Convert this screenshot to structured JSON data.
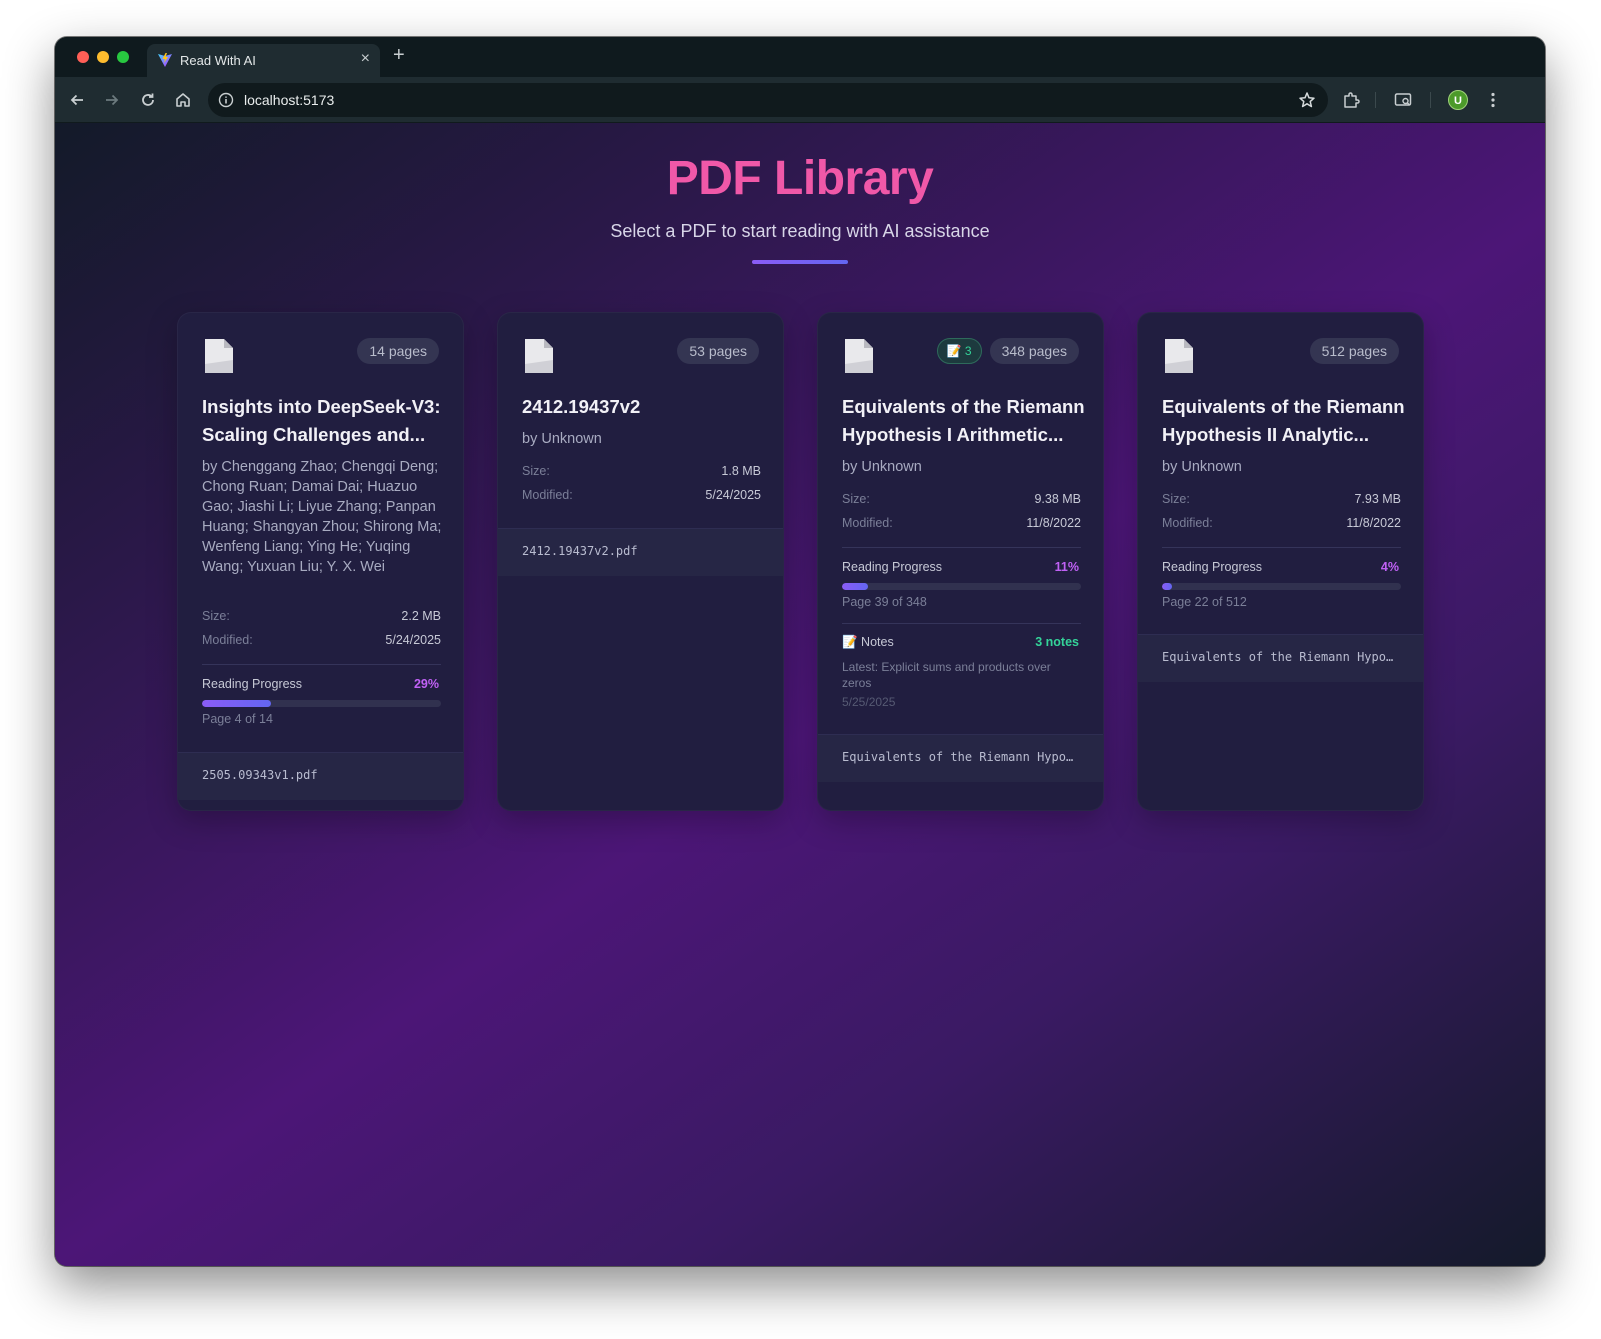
{
  "browser": {
    "tab_title": "Read With AI",
    "tab_close": "×",
    "new_tab": "+",
    "url": "localhost:5173",
    "avatar_initial": "U"
  },
  "page": {
    "title": "PDF Library",
    "subtitle": "Select a PDF to start reading with AI assistance",
    "accent_color": "#f058a8"
  },
  "labels": {
    "size": "Size:",
    "modified": "Modified:",
    "reading_progress": "Reading Progress",
    "notes": "📝 Notes"
  },
  "cards": [
    {
      "pages": "14 pages",
      "title": "Insights into DeepSeek-V3: Scaling Challenges and...",
      "author": "by Chenggang Zhao; Chengqi Deng; Chong Ruan; Damai Dai; Huazuo Gao; Jiashi Li; Liyue Zhang; Panpan Huang; Shangyan Zhou; Shirong Ma; Wenfeng Liang; Ying He; Yuqing Wang; Yuxuan Liu; Y. X. Wei",
      "size": "2.2 MB",
      "modified": "5/24/2025",
      "progress_pct": "29%",
      "progress_value": 0.29,
      "progress_page": "Page 4 of 14",
      "filename": "2505.09343v1.pdf"
    },
    {
      "pages": "53 pages",
      "title": "2412.19437v2",
      "author": "by Unknown",
      "size": "1.8 MB",
      "modified": "5/24/2025",
      "filename": "2412.19437v2.pdf"
    },
    {
      "pages": "348 pages",
      "notes_badge": "📝 3",
      "title": "Equivalents of the Riemann Hypothesis I Arithmetic...",
      "author": "by Unknown",
      "size": "9.38 MB",
      "modified": "11/8/2022",
      "progress_pct": "11%",
      "progress_value": 0.11,
      "progress_page": "Page 39 of 348",
      "notes_count": "3 notes",
      "notes_latest": "Latest: Explicit sums and products over zeros",
      "notes_date": "5/25/2025",
      "filename": "Equivalents of the Riemann Hypo…"
    },
    {
      "pages": "512 pages",
      "title": "Equivalents of the Riemann Hypothesis II Analytic...",
      "author": "by Unknown",
      "size": "7.93 MB",
      "modified": "11/8/2022",
      "progress_pct": "4%",
      "progress_value": 0.04,
      "progress_page": "Page 22 of 512",
      "filename": "Equivalents of the Riemann Hypo…"
    }
  ]
}
